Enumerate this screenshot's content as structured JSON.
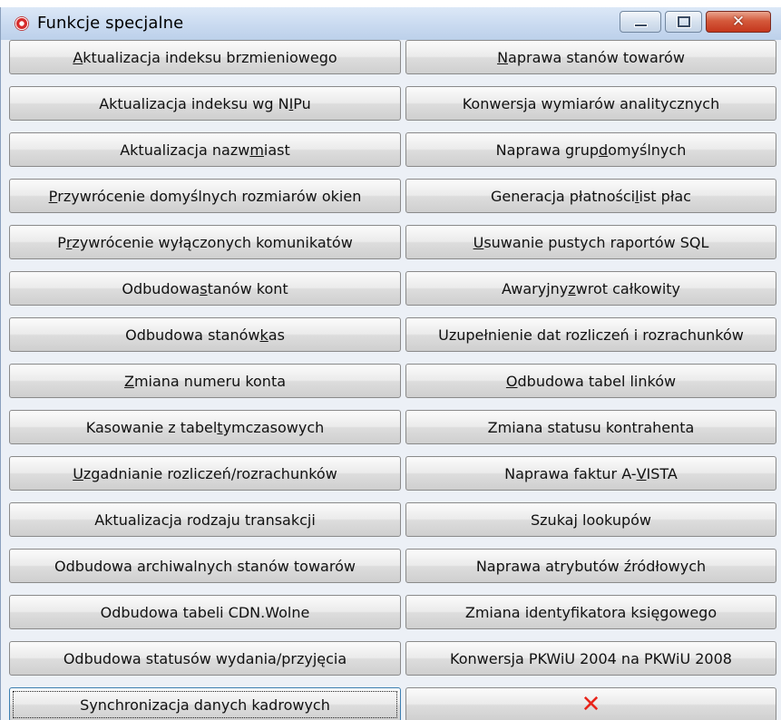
{
  "window": {
    "title": "Funkcje specjalne",
    "icon": "app-icon",
    "controls": {
      "minimize": "minimize-icon",
      "maximize": "maximize-icon",
      "close": "close-icon"
    },
    "close_glyph": "✕"
  },
  "left_buttons": [
    {
      "pre": "",
      "acc": "A",
      "post": "ktualizacja indeksu brzmieniowego"
    },
    {
      "pre": "Aktualizacja indeksu wg N",
      "acc": "I",
      "post": "Pu"
    },
    {
      "pre": "Aktualizacja nazw ",
      "acc": "m",
      "post": "iast"
    },
    {
      "pre": "",
      "acc": "P",
      "post": "rzywrócenie domyślnych rozmiarów okien"
    },
    {
      "pre": "P",
      "acc": "r",
      "post": "zywrócenie wyłączonych komunikatów"
    },
    {
      "pre": "Odbudowa ",
      "acc": "s",
      "post": "tanów kont"
    },
    {
      "pre": "Odbudowa stanów ",
      "acc": "k",
      "post": "as"
    },
    {
      "pre": "",
      "acc": "Z",
      "post": "miana numeru konta"
    },
    {
      "pre": "Kasowanie z tabel ",
      "acc": "t",
      "post": "ymczasowych"
    },
    {
      "pre": "",
      "acc": "U",
      "post": "zgadnianie rozliczeń/rozrachunków"
    },
    {
      "pre": "Aktualizacja rodzaju transakcji",
      "acc": "",
      "post": ""
    },
    {
      "pre": "Odbudowa archiwalnych stanów towarów",
      "acc": "",
      "post": ""
    },
    {
      "pre": "Odbudowa tabeli CDN.Wolne",
      "acc": "",
      "post": ""
    },
    {
      "pre": "Odbudowa statusów wydania/przyjęcia",
      "acc": "",
      "post": ""
    },
    {
      "pre": "Synchronizacja danych kadrowych",
      "acc": "",
      "post": ""
    }
  ],
  "right_buttons": [
    {
      "pre": "",
      "acc": "N",
      "post": "aprawa stanów towarów"
    },
    {
      "pre": "Konwersja wymiarów analitycznych",
      "acc": "",
      "post": ""
    },
    {
      "pre": "Naprawa grup ",
      "acc": "d",
      "post": "omyślnych"
    },
    {
      "pre": "Generacja płatności ",
      "acc": "l",
      "post": "ist płac"
    },
    {
      "pre": "",
      "acc": "U",
      "post": "suwanie pustych raportów SQL"
    },
    {
      "pre": "Awaryjny ",
      "acc": "z",
      "post": "wrot całkowity"
    },
    {
      "pre": "Uzupełnienie dat rozliczeń i rozrachunków",
      "acc": "",
      "post": ""
    },
    {
      "pre": "",
      "acc": "O",
      "post": "dbudowa tabel linków"
    },
    {
      "pre": "Zmiana statusu kontrahenta",
      "acc": "",
      "post": ""
    },
    {
      "pre": "Naprawa faktur A-",
      "acc": "V",
      "post": "ISTA"
    },
    {
      "pre": "Szukaj lookupów",
      "acc": "",
      "post": ""
    },
    {
      "pre": "Naprawa atrybutów źródłowych",
      "acc": "",
      "post": ""
    },
    {
      "pre": "Zmiana identyfikatora księgowego",
      "acc": "",
      "post": ""
    },
    {
      "pre": "Konwersja PKWiU 2004 na PKWiU 2008",
      "acc": "",
      "post": ""
    }
  ],
  "close_button": {
    "icon": "red-x-icon",
    "glyph": "✕",
    "color": "#e8241a"
  }
}
